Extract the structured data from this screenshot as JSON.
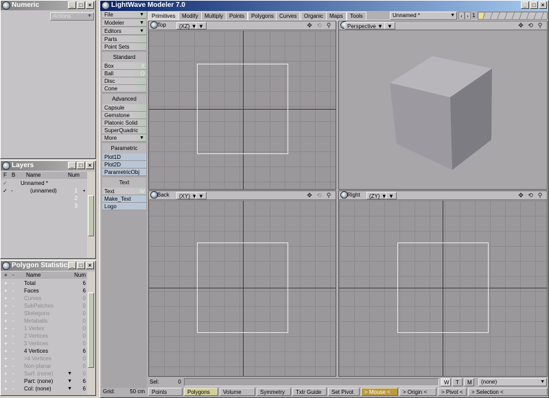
{
  "numeric": {
    "title": "Numeric",
    "actions": "Actions"
  },
  "layers": {
    "title": "Layers",
    "cols": {
      "f": "F",
      "b": "B",
      "name": "Name",
      "num": "Num"
    },
    "object": "Unnamed *",
    "rows": [
      {
        "check": "✓",
        "b": "-",
        "name": "(unnamed)",
        "num": "1"
      },
      {
        "check": "",
        "b": "",
        "name": "",
        "num": "2"
      },
      {
        "check": "",
        "b": "",
        "name": "",
        "num": "3"
      }
    ]
  },
  "polystats": {
    "title": "Polygon Statistics",
    "cols": {
      "plus": "+",
      "minus": "-",
      "name": "Name",
      "num": "Num"
    },
    "rows": [
      {
        "name": "Total",
        "num": "6",
        "dim": false
      },
      {
        "name": "Faces",
        "num": "6",
        "dim": false
      },
      {
        "name": "Curves",
        "num": "0",
        "dim": true
      },
      {
        "name": "SubPatches",
        "num": "0",
        "dim": true
      },
      {
        "name": "Skelegons",
        "num": "0",
        "dim": true
      },
      {
        "name": "Metaballs",
        "num": "0",
        "dim": true
      },
      {
        "name": "1 Vertex",
        "num": "0",
        "dim": true
      },
      {
        "name": "2 Vertices",
        "num": "0",
        "dim": true
      },
      {
        "name": "3 Vertices",
        "num": "0",
        "dim": true
      },
      {
        "name": "4 Vertices",
        "num": "6",
        "dim": false
      },
      {
        "name": ">4 Vertices",
        "num": "0",
        "dim": true
      },
      {
        "name": "Non-planar",
        "num": "0",
        "dim": true
      },
      {
        "name": "Surf: (none)",
        "num": "0",
        "dim": true
      },
      {
        "name": "Part: (none)",
        "num": "6",
        "dim": false
      },
      {
        "name": "Col: (none)",
        "num": "6",
        "dim": false
      }
    ]
  },
  "main": {
    "title": "LightWave Modeler 7.0"
  },
  "menu": {
    "file": "File",
    "modeler": "Modeler",
    "editors": "Editors",
    "parts": "Parts",
    "pointsets": "Point Sets",
    "standard": "Standard",
    "box": "Box",
    "box_key": "X",
    "ball": "Ball",
    "ball_key": "O",
    "disc": "Disc",
    "cone": "Cone",
    "advanced": "Advanced",
    "capsule": "Capsule",
    "gemstone": "Gemstone",
    "platonic": "Platonic Solid",
    "superquadric": "SuperQuadric",
    "more": "More",
    "parametric": "Parametric",
    "plot1d": "Plot1D",
    "plot2d": "Plot2D",
    "parametricobj": "ParametricObj",
    "text_hdr": "Text",
    "text": "Text",
    "text_key": "W",
    "make_text": "Make_Text",
    "logo": "Logo"
  },
  "tabs": [
    "Primitives",
    "Modify",
    "Multiply",
    "Points",
    "Polygons",
    "Curves",
    "Organic",
    "Maps",
    "Tools"
  ],
  "object_select": "Unnamed *",
  "layer_num": "1",
  "viewports": {
    "top": {
      "name": "Top",
      "axis": "(XZ)"
    },
    "persp": {
      "name": "Perspective"
    },
    "back": {
      "name": "Back",
      "axis": "(XY)"
    },
    "right": {
      "name": "Right",
      "axis": "(ZY)"
    }
  },
  "bottom": {
    "sel_label": "Sel:",
    "sel_value": "0",
    "grid_label": "Grid:",
    "grid_value": "50 cm",
    "w": "W",
    "t": "T",
    "m": "M",
    "none": "(none)",
    "buttons": [
      "Points",
      "Polygons",
      "Volume",
      "Symmetry",
      "Txtr Guide",
      "Set Pivot",
      "> Mouse <",
      "> Origin <",
      "> Pivot <",
      "> Selection <"
    ]
  }
}
